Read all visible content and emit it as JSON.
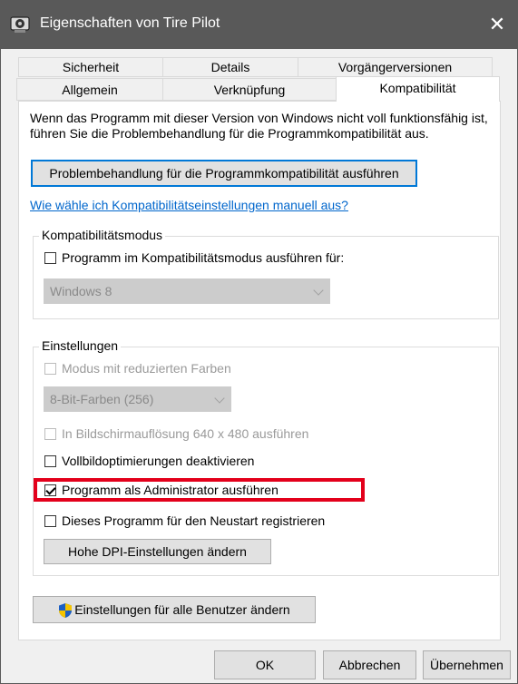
{
  "window": {
    "title": "Eigenschaften von Tire Pilot",
    "close_glyph": "✕"
  },
  "tabs_row1": [
    "Sicherheit",
    "Details",
    "Vorgängerversionen"
  ],
  "tabs_row2": [
    "Allgemein",
    "Verknüpfung",
    "Kompatibilität"
  ],
  "active_tab": "Kompatibilität",
  "description": "Wenn das Programm mit dieser Version von Windows nicht voll funktionsfähig ist, führen Sie die Problembehandlung für die Programmkompatibilität aus.",
  "troubleshoot_button": "Problembehandlung für die Programmkompatibilität ausführen",
  "manual_link": "Wie wähle ich Kompatibilitätseinstellungen manuell aus?",
  "compat_mode": {
    "group_label": "Kompatibilitätsmodus",
    "checkbox_label": "Programm im Kompatibilitätsmodus ausführen für:",
    "checked": false,
    "os_value": "Windows 8"
  },
  "settings": {
    "group_label": "Einstellungen",
    "reduced_color_label": "Modus mit reduzierten Farben",
    "color_value": "8-Bit-Farben (256)",
    "resolution_label": "In Bildschirmauflösung 640 x 480 ausführen",
    "fullscreen_opt_label": "Vollbildoptimierungen deaktivieren",
    "run_as_admin_label": "Programm als Administrator ausführen",
    "run_as_admin_checked": true,
    "restart_register_label": "Dieses Programm für den Neustart registrieren",
    "dpi_button": "Hohe DPI-Einstellungen ändern"
  },
  "all_users_button": "Einstellungen für alle Benutzer ändern",
  "footer": {
    "ok": "OK",
    "cancel": "Abbrechen",
    "apply": "Übernehmen"
  },
  "colors": {
    "titlebar": "#595959",
    "highlight": "#e3001b",
    "link": "#0066cc",
    "focus": "#0078d7"
  }
}
